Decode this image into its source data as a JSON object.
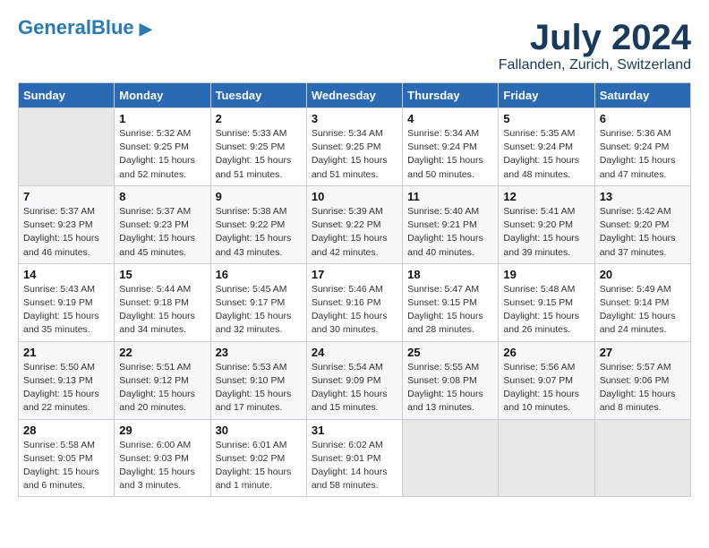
{
  "header": {
    "logo_general": "General",
    "logo_blue": "Blue",
    "main_title": "July 2024",
    "sub_title": "Fallanden, Zurich, Switzerland"
  },
  "calendar": {
    "columns": [
      "Sunday",
      "Monday",
      "Tuesday",
      "Wednesday",
      "Thursday",
      "Friday",
      "Saturday"
    ],
    "weeks": [
      [
        {
          "day": "",
          "info": ""
        },
        {
          "day": "1",
          "info": "Sunrise: 5:32 AM\nSunset: 9:25 PM\nDaylight: 15 hours\nand 52 minutes."
        },
        {
          "day": "2",
          "info": "Sunrise: 5:33 AM\nSunset: 9:25 PM\nDaylight: 15 hours\nand 51 minutes."
        },
        {
          "day": "3",
          "info": "Sunrise: 5:34 AM\nSunset: 9:25 PM\nDaylight: 15 hours\nand 51 minutes."
        },
        {
          "day": "4",
          "info": "Sunrise: 5:34 AM\nSunset: 9:24 PM\nDaylight: 15 hours\nand 50 minutes."
        },
        {
          "day": "5",
          "info": "Sunrise: 5:35 AM\nSunset: 9:24 PM\nDaylight: 15 hours\nand 48 minutes."
        },
        {
          "day": "6",
          "info": "Sunrise: 5:36 AM\nSunset: 9:24 PM\nDaylight: 15 hours\nand 47 minutes."
        }
      ],
      [
        {
          "day": "7",
          "info": "Sunrise: 5:37 AM\nSunset: 9:23 PM\nDaylight: 15 hours\nand 46 minutes."
        },
        {
          "day": "8",
          "info": "Sunrise: 5:37 AM\nSunset: 9:23 PM\nDaylight: 15 hours\nand 45 minutes."
        },
        {
          "day": "9",
          "info": "Sunrise: 5:38 AM\nSunset: 9:22 PM\nDaylight: 15 hours\nand 43 minutes."
        },
        {
          "day": "10",
          "info": "Sunrise: 5:39 AM\nSunset: 9:22 PM\nDaylight: 15 hours\nand 42 minutes."
        },
        {
          "day": "11",
          "info": "Sunrise: 5:40 AM\nSunset: 9:21 PM\nDaylight: 15 hours\nand 40 minutes."
        },
        {
          "day": "12",
          "info": "Sunrise: 5:41 AM\nSunset: 9:20 PM\nDaylight: 15 hours\nand 39 minutes."
        },
        {
          "day": "13",
          "info": "Sunrise: 5:42 AM\nSunset: 9:20 PM\nDaylight: 15 hours\nand 37 minutes."
        }
      ],
      [
        {
          "day": "14",
          "info": "Sunrise: 5:43 AM\nSunset: 9:19 PM\nDaylight: 15 hours\nand 35 minutes."
        },
        {
          "day": "15",
          "info": "Sunrise: 5:44 AM\nSunset: 9:18 PM\nDaylight: 15 hours\nand 34 minutes."
        },
        {
          "day": "16",
          "info": "Sunrise: 5:45 AM\nSunset: 9:17 PM\nDaylight: 15 hours\nand 32 minutes."
        },
        {
          "day": "17",
          "info": "Sunrise: 5:46 AM\nSunset: 9:16 PM\nDaylight: 15 hours\nand 30 minutes."
        },
        {
          "day": "18",
          "info": "Sunrise: 5:47 AM\nSunset: 9:15 PM\nDaylight: 15 hours\nand 28 minutes."
        },
        {
          "day": "19",
          "info": "Sunrise: 5:48 AM\nSunset: 9:15 PM\nDaylight: 15 hours\nand 26 minutes."
        },
        {
          "day": "20",
          "info": "Sunrise: 5:49 AM\nSunset: 9:14 PM\nDaylight: 15 hours\nand 24 minutes."
        }
      ],
      [
        {
          "day": "21",
          "info": "Sunrise: 5:50 AM\nSunset: 9:13 PM\nDaylight: 15 hours\nand 22 minutes."
        },
        {
          "day": "22",
          "info": "Sunrise: 5:51 AM\nSunset: 9:12 PM\nDaylight: 15 hours\nand 20 minutes."
        },
        {
          "day": "23",
          "info": "Sunrise: 5:53 AM\nSunset: 9:10 PM\nDaylight: 15 hours\nand 17 minutes."
        },
        {
          "day": "24",
          "info": "Sunrise: 5:54 AM\nSunset: 9:09 PM\nDaylight: 15 hours\nand 15 minutes."
        },
        {
          "day": "25",
          "info": "Sunrise: 5:55 AM\nSunset: 9:08 PM\nDaylight: 15 hours\nand 13 minutes."
        },
        {
          "day": "26",
          "info": "Sunrise: 5:56 AM\nSunset: 9:07 PM\nDaylight: 15 hours\nand 10 minutes."
        },
        {
          "day": "27",
          "info": "Sunrise: 5:57 AM\nSunset: 9:06 PM\nDaylight: 15 hours\nand 8 minutes."
        }
      ],
      [
        {
          "day": "28",
          "info": "Sunrise: 5:58 AM\nSunset: 9:05 PM\nDaylight: 15 hours\nand 6 minutes."
        },
        {
          "day": "29",
          "info": "Sunrise: 6:00 AM\nSunset: 9:03 PM\nDaylight: 15 hours\nand 3 minutes."
        },
        {
          "day": "30",
          "info": "Sunrise: 6:01 AM\nSunset: 9:02 PM\nDaylight: 15 hours\nand 1 minute."
        },
        {
          "day": "31",
          "info": "Sunrise: 6:02 AM\nSunset: 9:01 PM\nDaylight: 14 hours\nand 58 minutes."
        },
        {
          "day": "",
          "info": ""
        },
        {
          "day": "",
          "info": ""
        },
        {
          "day": "",
          "info": ""
        }
      ]
    ]
  }
}
